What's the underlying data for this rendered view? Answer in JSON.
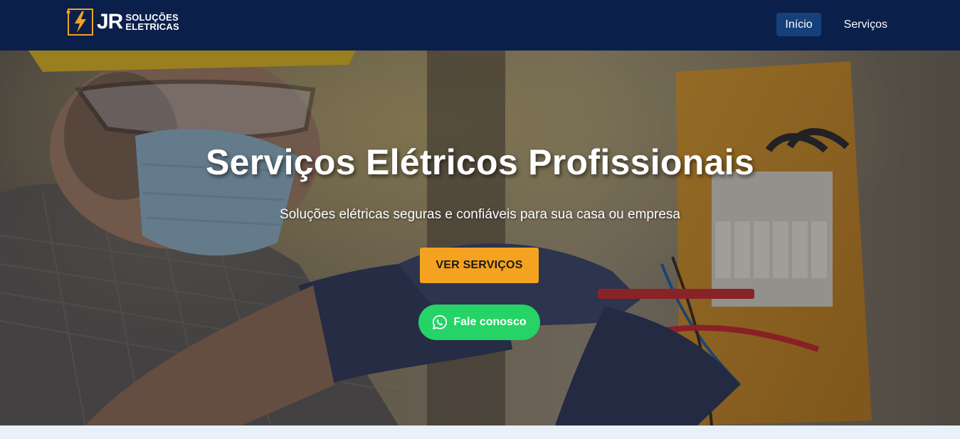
{
  "brand": {
    "logo_initials": "JR",
    "logo_line1": "SOLUÇÕES",
    "logo_line2": "ELETRICAS",
    "icon": "lightning-bolt-icon"
  },
  "nav": {
    "items": [
      {
        "label": "Início",
        "active": true
      },
      {
        "label": "Serviços",
        "active": false
      }
    ]
  },
  "hero": {
    "title": "Serviços Elétricos Profissionais",
    "subtitle": "Soluções elétricas seguras e confiáveis para sua casa ou empresa",
    "primary_button": "VER SERVIÇOS",
    "whatsapp_button": "Fale conosco",
    "whatsapp_icon": "whatsapp-icon",
    "background_image": "electrician-working-on-panel"
  },
  "colors": {
    "navbar": "#0b1f4b",
    "nav_active": "#16407a",
    "primary_button": "#f4a21f",
    "whatsapp": "#25d366",
    "section_below": "#e8f0fa"
  }
}
